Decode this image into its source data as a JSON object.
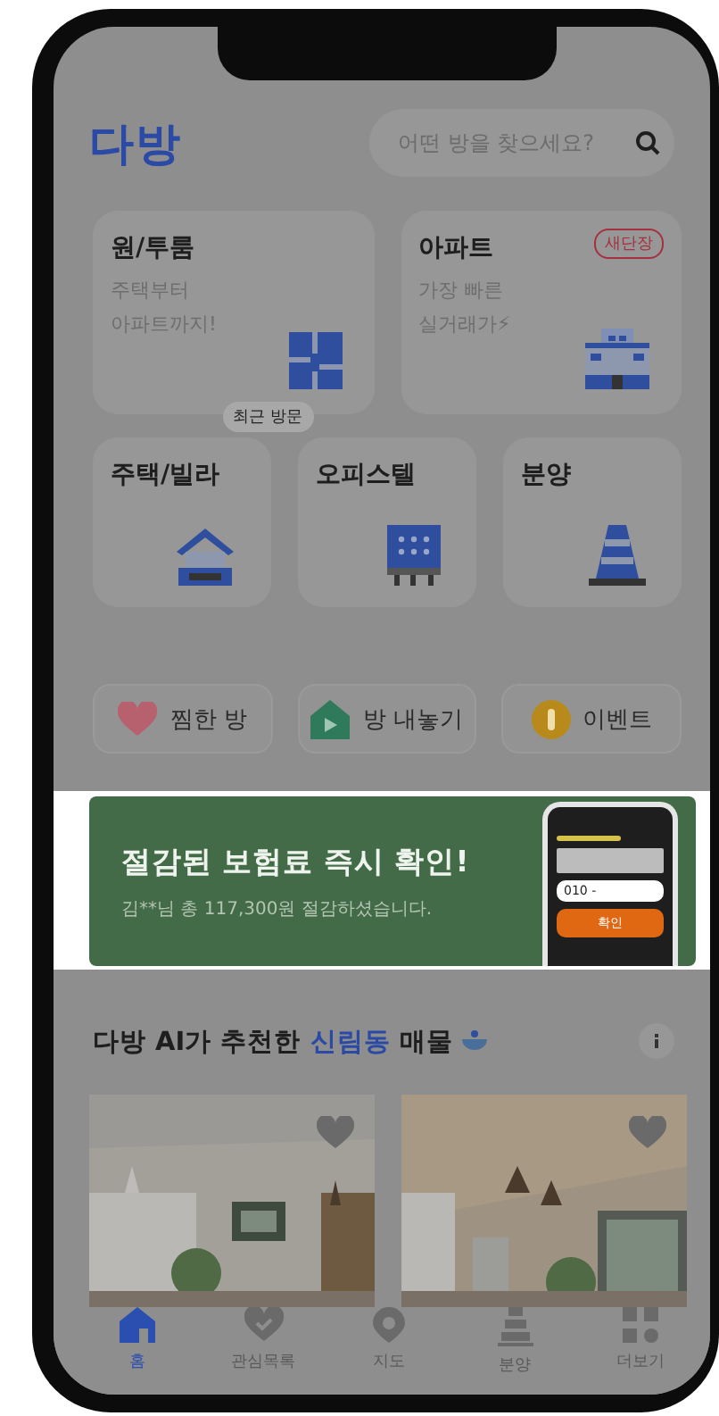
{
  "logo": {
    "text": "다방"
  },
  "search": {
    "placeholder": "어떤 방을 찾으세요?"
  },
  "categories": [
    {
      "title": "원/투룸",
      "lines": [
        "주택부터",
        "아파트까지!"
      ],
      "kind": "rooms",
      "tooltip": "최근 방문"
    },
    {
      "title": "아파트",
      "lines": [
        "가장 빠른",
        "실거래가⚡"
      ],
      "kind": "apartment",
      "badge": "새단장"
    },
    {
      "title": "주택/빌라",
      "kind": "house"
    },
    {
      "title": "오피스텔",
      "kind": "officetel"
    },
    {
      "title": "분양",
      "kind": "presale"
    }
  ],
  "quick_actions": [
    {
      "label": "찜한 방",
      "kind": "heart"
    },
    {
      "label": "방 내놓기",
      "kind": "upload"
    },
    {
      "label": "이벤트",
      "kind": "coin"
    }
  ],
  "banner": {
    "title": "절감된 보험료 즉시 확인!",
    "subtitle": "김**님 총 117,300원 절감하셨습니다.",
    "phone_input": "010 -",
    "phone_button": "확인"
  },
  "recommend": {
    "title_before": "다방 AI가 추천한",
    "area": "신림동",
    "title_after": "매물"
  },
  "nav": [
    {
      "label": "홈",
      "kind": "home",
      "selected": true
    },
    {
      "label": "관심목록",
      "kind": "heart",
      "selected": false
    },
    {
      "label": "지도",
      "kind": "map",
      "selected": false
    },
    {
      "label": "분양",
      "kind": "presale",
      "selected": false
    },
    {
      "label": "더보기",
      "kind": "more",
      "selected": false
    }
  ]
}
